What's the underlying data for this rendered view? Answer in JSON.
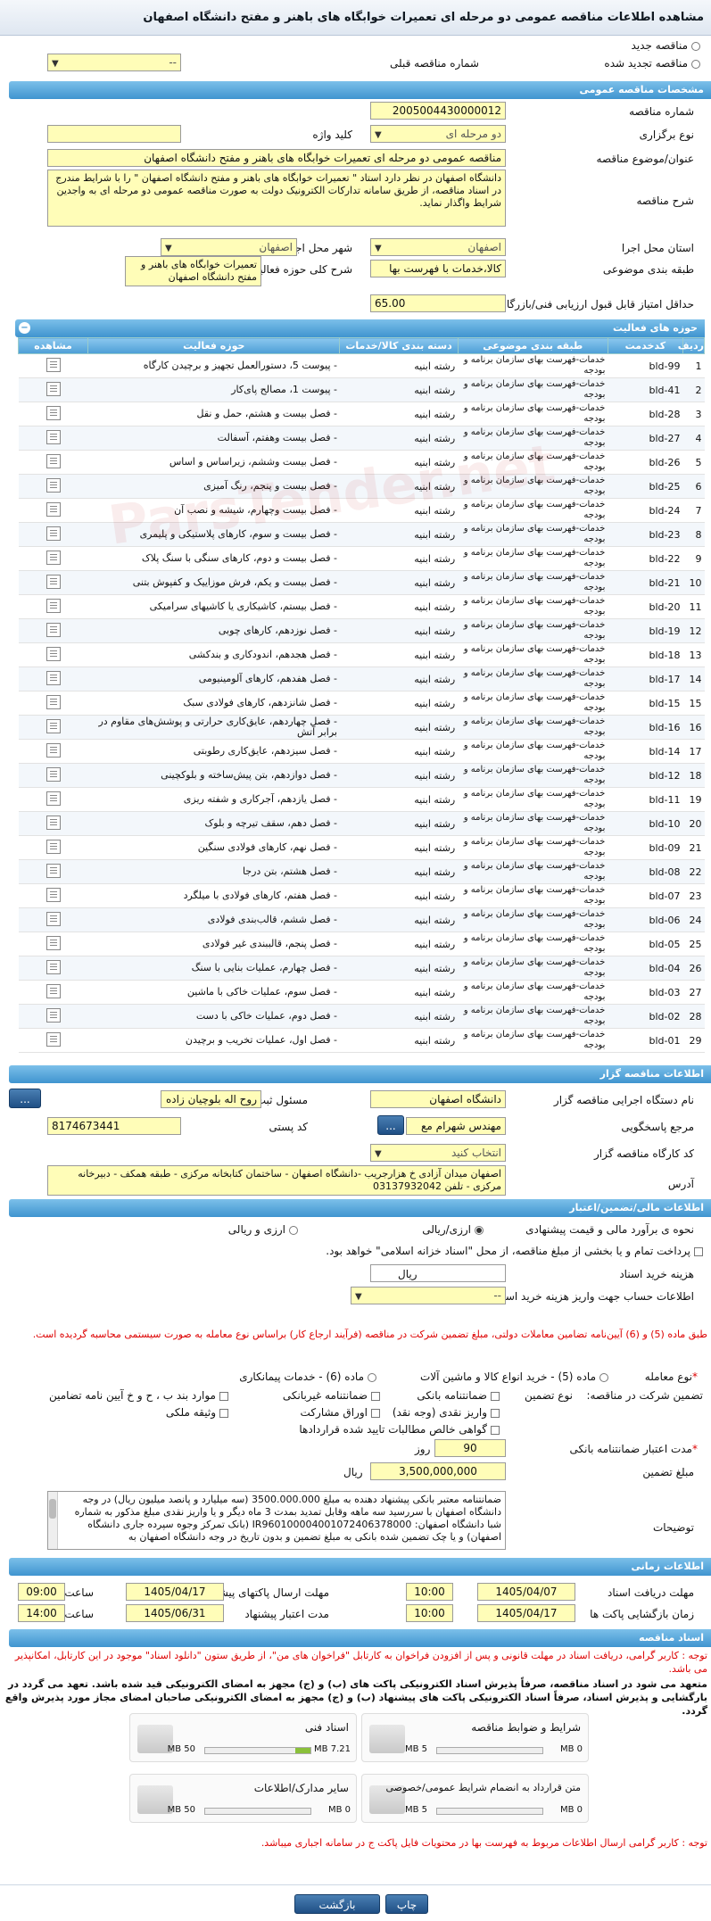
{
  "page_title": "مشاهده اطلاعات مناقصه عمومی دو مرحله ای تعمیرات خوابگاه های باهنر و مفتح دانشگاه اصفهان",
  "top": {
    "new_label": "مناقصه جدید",
    "renewed_label": "مناقصه تجدید شده",
    "prev_label": "شماره مناقصه قبلی",
    "prev_value": "--"
  },
  "general": {
    "header": "مشخصات مناقصه عمومی",
    "number_label": "شماره مناقصه",
    "number": "2005004430000012",
    "type_label": "نوع برگزاری",
    "type": "دو مرحله ای",
    "keyword_label": "کلید واژه",
    "keyword": "",
    "subject_label": "عنوان/موضوع مناقصه",
    "subject": "مناقصه عمومی دو مرحله ای تعمیرات خوابگاه های باهنر و مفتح دانشگاه اصفهان",
    "desc_label": "شرح مناقصه",
    "desc": "دانشگاه اصفهان در نظر دارد استاد \" تعمیرات خوابگاه های باهنر و مفتح دانشگاه اصفهان \" را با شرایط مندرج در اسناد مناقصه، از طریق سامانه تدارکات الکترونیک دولت به صورت مناقصه عمومی دو مرحله ای به واجدین شرایط واگذار نماید.",
    "province_label": "استان محل اجرا",
    "province": "اصفهان",
    "city_label": "شهر محل اجرا",
    "city": "اصفهان",
    "category_label": "طبقه بندی موضوعی",
    "category": "کالا،خدمات با فهرست بها",
    "scope_label": "شرح کلی حوزه فعالیت",
    "scope": "تعمیرات خوابگاه های باهنر و مفتح دانشگاه اصفهان",
    "minscore_label": "حداقل امتیاز قابل قبول ارزیابی فنی/بازرگانی",
    "minscore": "65.00"
  },
  "activity": {
    "header": "حوزه های فعالیت",
    "cols": [
      "ردیف",
      "کدخدمت",
      "طبقه بندی موضوعی",
      "دسته بندی کالا/خدمات",
      "حوزه فعالیت",
      "مشاهده"
    ],
    "rows": [
      [
        "1",
        "bld-99",
        "خدمات-فهرست بهای سازمان برنامه و بودجه",
        "رشته ابنیه",
        "- پیوست 5، دستورالعمل تجهیز و برچیدن کارگاه"
      ],
      [
        "2",
        "bld-41",
        "خدمات-فهرست بهای سازمان برنامه و بودجه",
        "رشته ابنیه",
        "- پیوست 1، مصالح پای‌کار"
      ],
      [
        "3",
        "bld-28",
        "خدمات-فهرست بهای سازمان برنامه و بودجه",
        "رشته ابنیه",
        "- فصل بیست و هشتم، حمل و نقل"
      ],
      [
        "4",
        "bld-27",
        "خدمات-فهرست بهای سازمان برنامه و بودجه",
        "رشته ابنیه",
        "- فصل بیست وهفتم، آسفالت"
      ],
      [
        "5",
        "bld-26",
        "خدمات-فهرست بهای سازمان برنامه و بودجه",
        "رشته ابنیه",
        "- فصل بیست وششم، زیراساس و اساس"
      ],
      [
        "6",
        "bld-25",
        "خدمات-فهرست بهای سازمان برنامه و بودجه",
        "رشته ابنیه",
        "- فصل بیست و پنجم، رنگ آمیزی"
      ],
      [
        "7",
        "bld-24",
        "خدمات-فهرست بهای سازمان برنامه و بودجه",
        "رشته ابنیه",
        "- فصل بیست وچهارم، شیشه و نصب آن"
      ],
      [
        "8",
        "bld-23",
        "خدمات-فهرست بهای سازمان برنامه و بودجه",
        "رشته ابنیه",
        "- فصل بیست و سوم، کارهای پلاستیکی و پلیمری"
      ],
      [
        "9",
        "bld-22",
        "خدمات-فهرست بهای سازمان برنامه و بودجه",
        "رشته ابنیه",
        "- فصل بیست و دوم، کارهای سنگی با سنگ پلاک"
      ],
      [
        "10",
        "bld-21",
        "خدمات-فهرست بهای سازمان برنامه و بودجه",
        "رشته ابنیه",
        "- فصل بیست و یکم، فرش موزاییک و کفپوش بتنی"
      ],
      [
        "11",
        "bld-20",
        "خدمات-فهرست بهای سازمان برنامه و بودجه",
        "رشته ابنیه",
        "- فصل بیستم، کاشیکاری یا کاشیهای سرامیکی"
      ],
      [
        "12",
        "bld-19",
        "خدمات-فهرست بهای سازمان برنامه و بودجه",
        "رشته ابنیه",
        "- فصل نوزدهم، کارهای چوبی"
      ],
      [
        "13",
        "bld-18",
        "خدمات-فهرست بهای سازمان برنامه و بودجه",
        "رشته ابنیه",
        "- فصل هجدهم، اندودکاری و بندکشی"
      ],
      [
        "14",
        "bld-17",
        "خدمات-فهرست بهای سازمان برنامه و بودجه",
        "رشته ابنیه",
        "- فصل هفدهم، کارهای آلومینیومی"
      ],
      [
        "15",
        "bld-15",
        "خدمات-فهرست بهای سازمان برنامه و بودجه",
        "رشته ابنیه",
        "- فصل شانزدهم، کارهای فولادی سبک"
      ],
      [
        "16",
        "bld-16",
        "خدمات-فهرست بهای سازمان برنامه و بودجه",
        "رشته ابنیه",
        "- فصل چهاردهم، عایق‌کاری حرارتی و پوشش‌های مقاوم در برابر آتش"
      ],
      [
        "17",
        "bld-14",
        "خدمات-فهرست بهای سازمان برنامه و بودجه",
        "رشته ابنیه",
        "- فصل سیزدهم، عایق‌کاری رطوبتی"
      ],
      [
        "18",
        "bld-12",
        "خدمات-فهرست بهای سازمان برنامه و بودجه",
        "رشته ابنیه",
        "- فصل دوازدهم، بتن پیش‌ساخته و بلوکچینی"
      ],
      [
        "19",
        "bld-11",
        "خدمات-فهرست بهای سازمان برنامه و بودجه",
        "رشته ابنیه",
        "- فصل یازدهم، آجرکاری و شفته ریزی"
      ],
      [
        "20",
        "bld-10",
        "خدمات-فهرست بهای سازمان برنامه و بودجه",
        "رشته ابنیه",
        "- فصل دهم، سقف تیرچه و بلوک"
      ],
      [
        "21",
        "bld-09",
        "خدمات-فهرست بهای سازمان برنامه و بودجه",
        "رشته ابنیه",
        "- فصل نهم، کارهای فولادی سنگین"
      ],
      [
        "22",
        "bld-08",
        "خدمات-فهرست بهای سازمان برنامه و بودجه",
        "رشته ابنیه",
        "- فصل هشتم، بتن درجا"
      ],
      [
        "23",
        "bld-07",
        "خدمات-فهرست بهای سازمان برنامه و بودجه",
        "رشته ابنیه",
        "- فصل هفتم، کارهای فولادی با میلگرد"
      ],
      [
        "24",
        "bld-06",
        "خدمات-فهرست بهای سازمان برنامه و بودجه",
        "رشته ابنیه",
        "- فصل ششم، قالب‌بندی فولادی"
      ],
      [
        "25",
        "bld-05",
        "خدمات-فهرست بهای سازمان برنامه و بودجه",
        "رشته ابنیه",
        "- فصل پنجم، قالببندی غیر فولادی"
      ],
      [
        "26",
        "bld-04",
        "خدمات-فهرست بهای سازمان برنامه و بودجه",
        "رشته ابنیه",
        "- فصل چهارم، عملیات بنایی با سنگ"
      ],
      [
        "27",
        "bld-03",
        "خدمات-فهرست بهای سازمان برنامه و بودجه",
        "رشته ابنیه",
        "- فصل سوم، عملیات خاکی با ماشین"
      ],
      [
        "28",
        "bld-02",
        "خدمات-فهرست بهای سازمان برنامه و بودجه",
        "رشته ابنیه",
        "- فصل دوم، عملیات خاکی با دست"
      ],
      [
        "29",
        "bld-01",
        "خدمات-فهرست بهای سازمان برنامه و بودجه",
        "رشته ابنیه",
        "- فصل اول، عملیات تخریب و برچیدن"
      ]
    ]
  },
  "organizer": {
    "header": "اطلاعات مناقصه گزار",
    "org_label": "نام دستگاه اجرایی مناقصه گزار",
    "org": "دانشگاه اصفهان",
    "official_label": "مسئول ثبت مناقصه",
    "official": "روح اله بلوچیان زاده",
    "ref_label": "مرجع پاسخگویی",
    "ref": "مهندس شهرام مع",
    "postal_label": "کد پستی",
    "postal": "8174673441",
    "workshop_label": "کد کارگاه مناقصه گزار",
    "workshop": "انتخاب کنید",
    "address_label": "آدرس",
    "address": "اصفهان میدان آزادی خ هزارجریب -دانشگاه اصفهان - ساختمان کتابخانه مرکزی - طبقه همکف - دبیرخانه مرکزی - تلفن 03137932042",
    "more_btn": "..."
  },
  "finance": {
    "header": "اطلاعات مالی/تضمین/اعتبار",
    "estimate_label": "نحوه ی برآورد مالی و قیمت پیشنهادی",
    "rial_label": "ارزی/ریالی",
    "currency_label": "ارزی و ریالی",
    "partial_label": "پرداخت تمام و یا بخشی از مبلغ مناقصه، از محل \"اسناد خزانه اسلامی\" خواهد بود.",
    "doc_cost_label": "هزینه خرید اسناد",
    "doc_cost_unit": "ریال",
    "account_label": "اطلاعات حساب جهت واریز هزینه خرید اسناد",
    "account": "--",
    "warning": "طبق ماده (5) و (6) آیین‌نامه تضامین معاملات دولتی، مبلغ تضمین شرکت در مناقصه (فرآیند ارجاع کار) براساس نوع معامله به صورت سیستمی محاسبه گردیده است.",
    "deal_type_label": "نوع معامله",
    "deal_opts": [
      "ماده (5) - خرید انواع کالا و ماشین آلات",
      "ماده (6) - خدمات پیمانکاری"
    ],
    "guarantee_label": "تضمین شرکت در مناقصه:",
    "guarantee_type_label": "نوع تضمین",
    "g_opts": [
      "ضمانتنامه بانکی",
      "ضمانتنامه غیربانکی",
      "موارد بند ب ، ح و خ آیین نامه تضامین",
      "واریز نقدی (وجه نقد)",
      "اوراق مشارکت",
      "وثیقه ملکی",
      "گواهی خالص مطالبات تایید شده قراردادها"
    ],
    "validity_label": "مدت اعتبار ضمانتنامه بانکی",
    "validity": "90",
    "validity_unit": "روز",
    "amount_label": "مبلغ تضمین",
    "amount": "3,500,000,000",
    "amount_unit": "ریال",
    "notes_label": "توضیحات",
    "notes": "ضمانتنامه معتبر بانکی پیشنهاد دهنده به مبلغ 3500.000.000 (سه میلیارد و پانصد میلیون ریال) در وجه دانشگاه اصفهان با سررسید سه ماهه وقابل تمدید بمدت 3 ماه دیگر و یا واریز نقدی مبلغ مذکور به شماره شبا دانشگاه اصفهان: IR960100004001072406378000 (بانک تمرکز وجوه سپرده جاری دانشگاه اصفهان) و یا چک تضمین شده بانکی به مبلغ تضمین و بدون تاریخ در وجه دانشگاه اصفهان به"
  },
  "timing": {
    "header": "اطلاعات زمانی",
    "recv_doc_label": "مهلت دریافت اسناد",
    "recv_doc_date": "1405/04/07",
    "recv_doc_time": "10:00",
    "send_offer_label": "مهلت ارسال پاکتهای پیشنهاد",
    "send_offer_date": "1405/04/17",
    "send_offer_time": "09:00",
    "open_label": "زمان بازگشایی پاکت ها",
    "open_date": "1405/04/17",
    "open_time": "10:00",
    "validity_label": "مدت اعتبار پیشنهاد",
    "validity_date": "1405/06/31",
    "validity_time": "14:00",
    "time_label": "ساعت",
    "date_label": "تاریخ"
  },
  "documents": {
    "header": "اسناد مناقصه",
    "note1": "توجه : کاربر گرامی، دریافت اسناد در مهلت قانونی و پس از افزودن فراخوان به کارتابل \"فراخوان های من\"، از طریق ستون \"دانلود اسناد\" موجود در این کارتابل، امکانپذیر می باشد.",
    "note2": "متعهد می شود در اسناد مناقصه، صرفاً پذیرش اسناد الکترونیکی پاکت های (ب) و (ج) مجهز به امضای الکترونیکی قید شده باشد. تعهد می گردد در بارگشایی و پذیرش اسناد، صرفاً اسناد الکترونیکی پاکت های پیشنهاد (ب) و (ج) مجهز به امضای الکترونیکی صاحبان امضای مجاز مورد پذیرش واقع گردد.",
    "files": [
      {
        "name": "شرایط و ضوابط مناقصه",
        "used": "0 MB",
        "max": "5 MB",
        "fill": 0
      },
      {
        "name": "اسناد فنی",
        "used": "7.21 MB",
        "max": "50 MB",
        "fill": 0.144
      },
      {
        "name": "متن قرارداد به انضمام شرایط عمومی/خصوصی",
        "used": "0 MB",
        "max": "5 MB",
        "fill": 0
      },
      {
        "name": "سایر مدارک/اطلاعات",
        "used": "0 MB",
        "max": "50 MB",
        "fill": 0
      }
    ],
    "note3": "توجه : کاربر گرامی ارسال اطلاعات مربوط به فهرست بها در محتویات فایل پاکت ج در سامانه اجباری میباشد."
  },
  "footer": {
    "print": "چاپ",
    "back": "بازگشت"
  },
  "watermark": "ParsTender.net"
}
